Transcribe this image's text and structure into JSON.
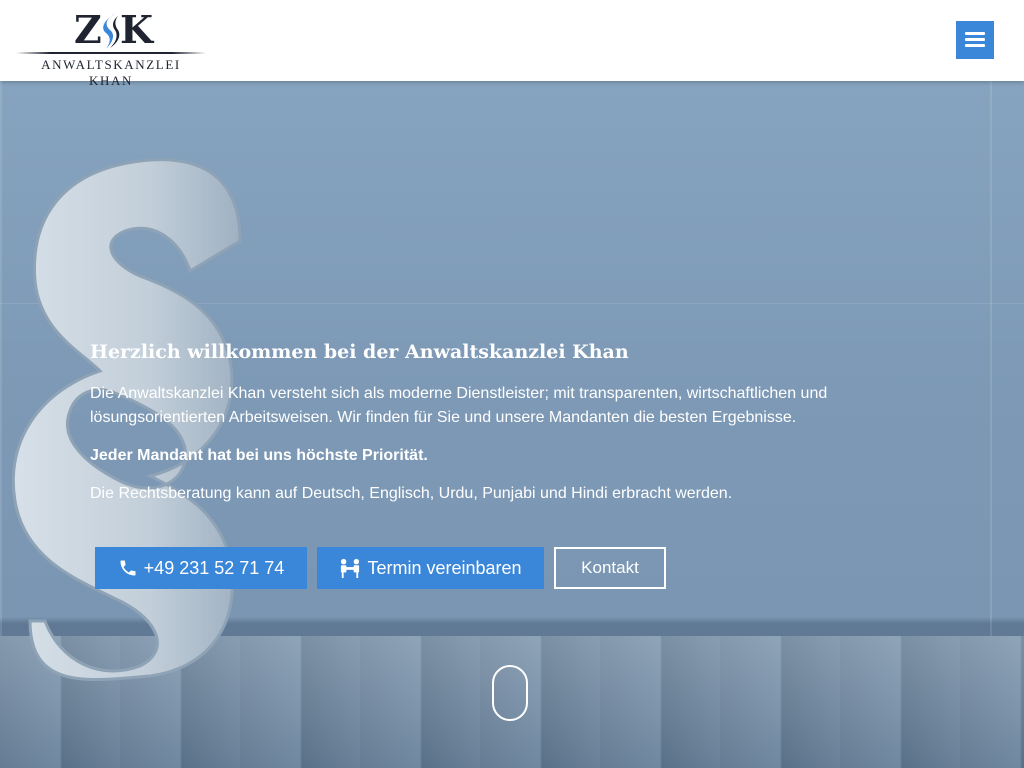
{
  "header": {
    "logo": {
      "mark_left": "Z",
      "mark_right": "K",
      "name": "ANWALTSKANZLEI KHAN"
    },
    "menu_icon": "hamburger-menu-icon"
  },
  "hero": {
    "headline": "Herzlich willkommen bei der Anwaltskanzlei Khan",
    "intro": "Die Anwaltskanzlei Khan versteht sich als moderne Dienstleister; mit transparenten, wirtschaftlichen und lösungsorientierten Arbeitsweisen. Wir finden für Sie und unsere Mandanten die besten Ergebnisse.",
    "priority": "Jeder Mandant hat bei uns höchste Priorität.",
    "languages": "Die Rechtsberatung kann auf Deutsch, Englisch, Urdu, Punjabi und Hindi erbracht werden.",
    "buttons": {
      "phone": "+49 231 52 71 74",
      "appointment": "Termin vereinbaren",
      "contact": "Kontakt"
    },
    "icons": {
      "phone": "phone-icon",
      "appointment": "handshake-icon",
      "scroll": "mouse-scroll-icon"
    }
  },
  "colors": {
    "accent": "#3a86d8",
    "text_on_hero": "#ffffff",
    "logo_dark": "#1f2430",
    "logo_blue": "#3a86d8"
  }
}
